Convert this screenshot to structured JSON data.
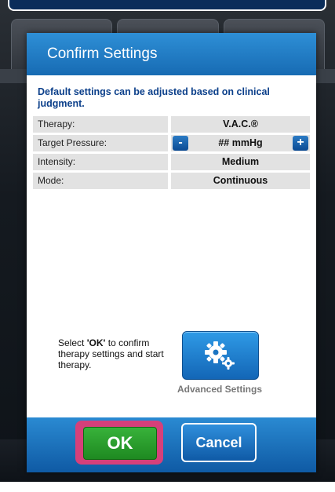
{
  "dialog": {
    "title": "Confirm Settings",
    "note": "Default settings can be adjusted based on clinical judgment."
  },
  "settings": [
    {
      "label": "Therapy:",
      "value": "V.A.C.®"
    },
    {
      "label": "Target Pressure:",
      "value": "## mmHg"
    },
    {
      "label": "Intensity:",
      "value": "Medium"
    },
    {
      "label": "Mode:",
      "value": "Continuous"
    }
  ],
  "stepper": {
    "minus": "-",
    "plus": "+"
  },
  "confirm": {
    "prefix": "Select ",
    "ok_ref": "'OK'",
    "suffix": " to confirm therapy settings and start therapy."
  },
  "advanced": {
    "label": "Advanced Settings",
    "icon": "gears-icon"
  },
  "footer": {
    "ok_label": "OK",
    "cancel_label": "Cancel",
    "highlight_color": "#d6407a",
    "ok_color": "#2a9e2d",
    "accent": "#1f7ac4"
  }
}
